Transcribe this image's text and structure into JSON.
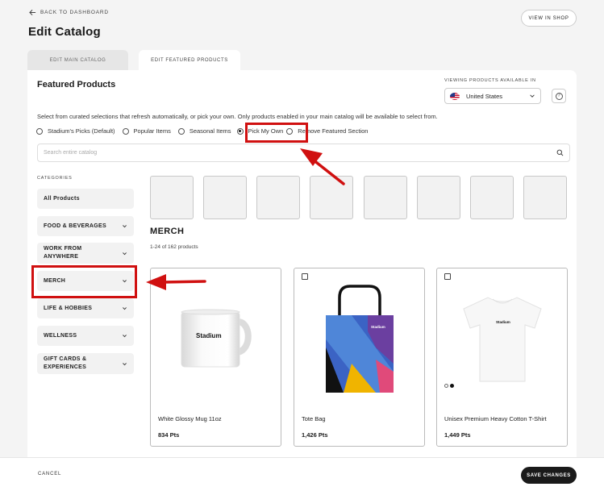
{
  "header": {
    "back_label": "BACK TO DASHBOARD",
    "title": "Edit Catalog",
    "view_shop_label": "VIEW IN SHOP"
  },
  "tabs": [
    {
      "label": "EDIT MAIN CATALOG",
      "active": false
    },
    {
      "label": "EDIT FEATURED PRODUCTS",
      "active": true
    }
  ],
  "panel": {
    "title": "Featured Products",
    "viewing_label": "VIEWING PRODUCTS AVAILABLE IN",
    "country": "United States",
    "description": "Select from curated selections that refresh automatically, or pick your own. Only products enabled in your main catalog will be available to select from.",
    "radios": [
      {
        "label": "Stadium's Picks (Default)",
        "selected": false
      },
      {
        "label": "Popular Items",
        "selected": false
      },
      {
        "label": "Seasonal Items",
        "selected": false
      },
      {
        "label": "Pick My Own",
        "selected": true
      },
      {
        "label": "Remove Featured Section",
        "selected": false
      }
    ],
    "search_placeholder": "Search entire catalog"
  },
  "categories": {
    "label": "CATEGORIES",
    "items": [
      {
        "label": "All Products"
      },
      {
        "label": "FOOD & BEVERAGES"
      },
      {
        "label": "WORK FROM\nANYWHERE"
      },
      {
        "label": "MERCH"
      },
      {
        "label": "LIFE & HOBBIES"
      },
      {
        "label": "WELLNESS"
      },
      {
        "label": "GIFT CARDS &\nEXPERIENCES"
      }
    ]
  },
  "products_section": {
    "title": "MERCH",
    "count": "1-24 of 162 products",
    "products": [
      {
        "name": "White Glossy Mug 11oz",
        "points": "834 Pts",
        "brand": "Stadium"
      },
      {
        "name": "Tote Bag",
        "points": "1,426 Pts",
        "brand": "Stadium"
      },
      {
        "name": "Unisex Premium Heavy Cotton T-Shirt",
        "points": "1,449 Pts",
        "brand": "Stadium"
      }
    ]
  },
  "footer": {
    "cancel_label": "CANCEL",
    "save_label": "SAVE CHANGES"
  },
  "colors": {
    "highlight": "#d01010",
    "primary_button": "#1a1a1a"
  }
}
